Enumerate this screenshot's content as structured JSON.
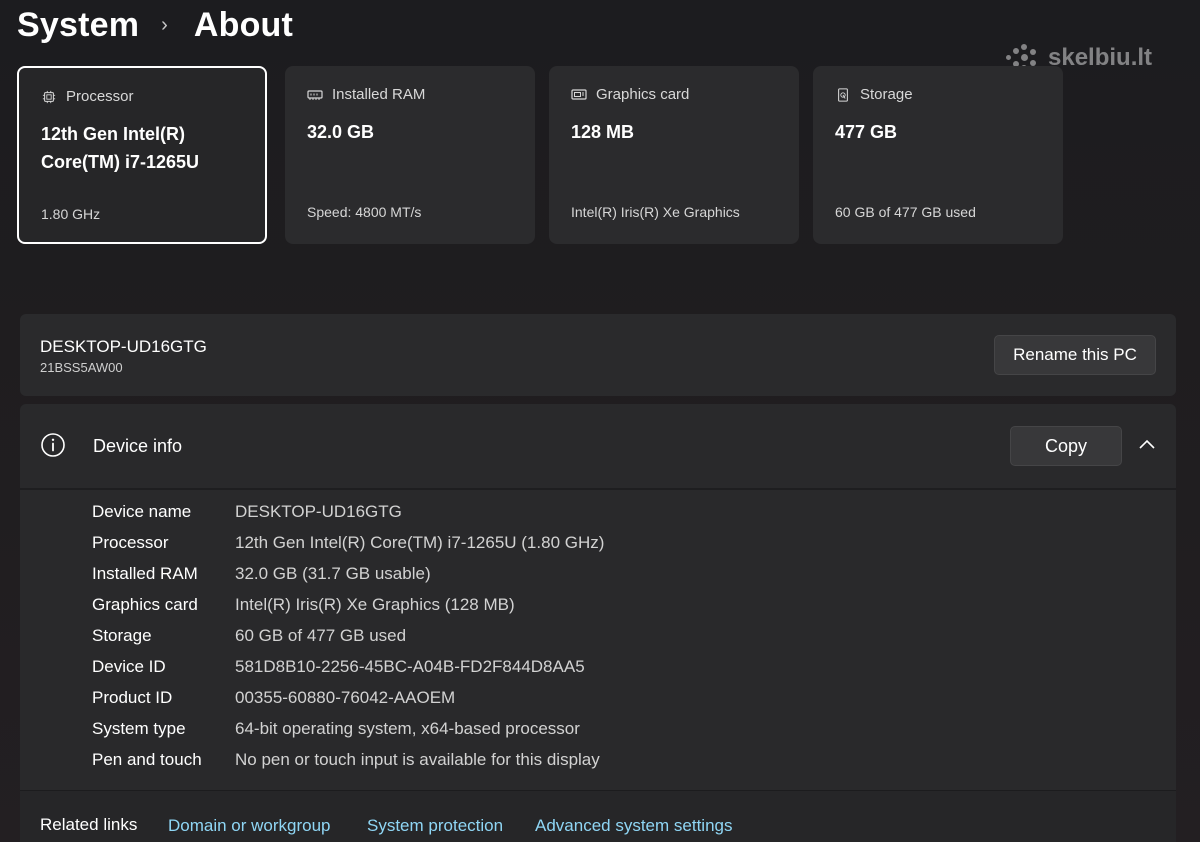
{
  "breadcrumb": {
    "parent": "System",
    "separator": "›",
    "current": "About"
  },
  "watermark": {
    "text": "skelbiu.lt"
  },
  "cards": [
    {
      "label": "Processor",
      "icon": "processor-icon",
      "value": "12th Gen Intel(R) Core(TM) i7-1265U",
      "sub": "1.80 GHz",
      "selected": true
    },
    {
      "label": "Installed RAM",
      "icon": "ram-icon",
      "value": "32.0 GB",
      "sub": "Speed: 4800 MT/s",
      "selected": false
    },
    {
      "label": "Graphics card",
      "icon": "graphics-card-icon",
      "value": "128 MB",
      "sub": "Intel(R) Iris(R) Xe Graphics",
      "selected": false
    },
    {
      "label": "Storage",
      "icon": "storage-icon",
      "value": "477 GB",
      "sub": "60 GB of 477 GB used",
      "selected": false
    }
  ],
  "pc": {
    "name": "DESKTOP-UD16GTG",
    "model": "21BSS5AW00",
    "rename_label": "Rename this PC"
  },
  "device_info": {
    "title": "Device info",
    "copy_label": "Copy",
    "specs": [
      {
        "label": "Device name",
        "value": "DESKTOP-UD16GTG"
      },
      {
        "label": "Processor",
        "value": "12th Gen Intel(R) Core(TM) i7-1265U (1.80 GHz)"
      },
      {
        "label": "Installed RAM",
        "value": "32.0 GB (31.7 GB usable)"
      },
      {
        "label": "Graphics card",
        "value": "Intel(R) Iris(R) Xe Graphics (128 MB)"
      },
      {
        "label": "Storage",
        "value": "60 GB of 477 GB used"
      },
      {
        "label": "Device ID",
        "value": "581D8B10-2256-45BC-A04B-FD2F844D8AA5"
      },
      {
        "label": "Product ID",
        "value": "00355-60880-76042-AAOEM"
      },
      {
        "label": "System type",
        "value": "64-bit operating system, x64-based processor"
      },
      {
        "label": "Pen and touch",
        "value": "No pen or touch input is available for this display"
      }
    ]
  },
  "related": {
    "label": "Related links",
    "links": [
      "Domain or workgroup",
      "System protection",
      "Advanced system settings"
    ]
  },
  "colors": {
    "link": "#8fd6f5",
    "card_bg": "#2b2b2d",
    "panel_bg": "#29292b"
  }
}
